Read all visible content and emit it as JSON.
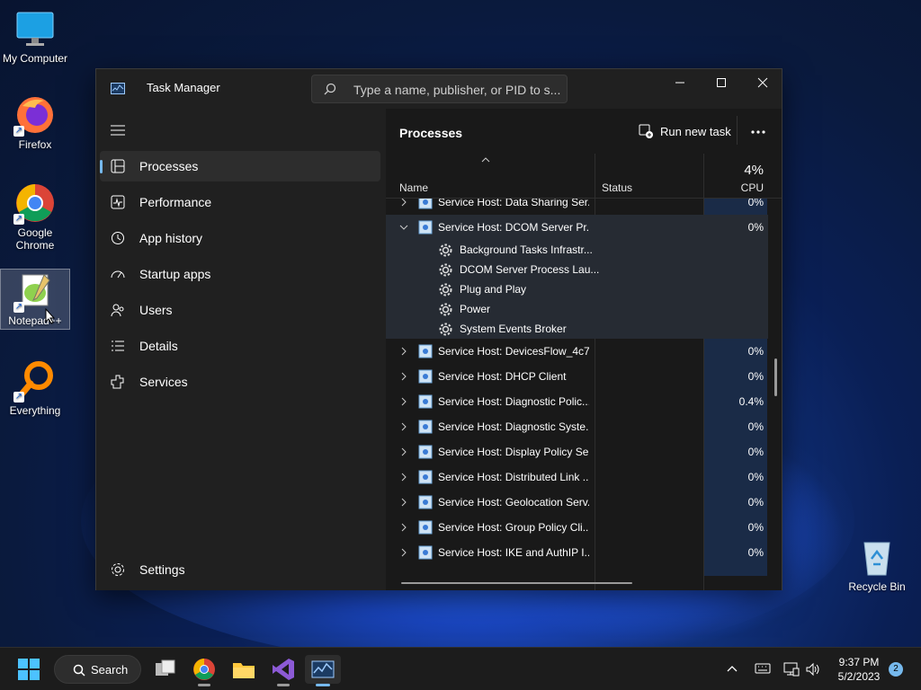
{
  "desktop": {
    "icons": [
      {
        "label": "My Computer"
      },
      {
        "label": "Firefox"
      },
      {
        "label": "Google Chrome"
      },
      {
        "label": "Notepad++"
      },
      {
        "label": "Everything"
      },
      {
        "label": "Recycle Bin"
      }
    ]
  },
  "window": {
    "title": "Task Manager",
    "search_placeholder": "Type a name, publisher, or PID to s..."
  },
  "sidebar": {
    "items": [
      {
        "label": "Processes",
        "icon": "processes-icon",
        "active": true
      },
      {
        "label": "Performance",
        "icon": "performance-icon"
      },
      {
        "label": "App history",
        "icon": "app-history-icon"
      },
      {
        "label": "Startup apps",
        "icon": "startup-apps-icon"
      },
      {
        "label": "Users",
        "icon": "users-icon"
      },
      {
        "label": "Details",
        "icon": "details-icon"
      },
      {
        "label": "Services",
        "icon": "services-icon"
      }
    ],
    "settings_label": "Settings"
  },
  "main": {
    "page_title": "Processes",
    "run_new_task": "Run new task",
    "columns": {
      "name": "Name",
      "status": "Status",
      "cpu_total": "4%",
      "cpu": "CPU"
    },
    "rows": [
      {
        "name": "Service Host: Data Sharing Ser...",
        "cpu": "0%"
      },
      {
        "name": "Service Host: DCOM Server Pr...",
        "cpu": "0%",
        "expanded": true
      },
      {
        "name": "Service Host: DevicesFlow_4c7...",
        "cpu": "0%"
      },
      {
        "name": "Service Host: DHCP Client",
        "cpu": "0%"
      },
      {
        "name": "Service Host: Diagnostic Polic...",
        "cpu": "0.4%"
      },
      {
        "name": "Service Host: Diagnostic Syste...",
        "cpu": "0%"
      },
      {
        "name": "Service Host: Display Policy Se...",
        "cpu": "0%"
      },
      {
        "name": "Service Host: Distributed Link ...",
        "cpu": "0%"
      },
      {
        "name": "Service Host: Geolocation Serv...",
        "cpu": "0%"
      },
      {
        "name": "Service Host: Group Policy Cli...",
        "cpu": "0%"
      },
      {
        "name": "Service Host: IKE and AuthIP I...",
        "cpu": "0%"
      }
    ],
    "children": [
      {
        "name": "Background Tasks Infrastr..."
      },
      {
        "name": "DCOM Server Process Lau..."
      },
      {
        "name": "Plug and Play"
      },
      {
        "name": "Power"
      },
      {
        "name": "System Events Broker"
      }
    ]
  },
  "taskbar": {
    "search_label": "Search",
    "time": "9:37 PM",
    "date": "5/2/2023",
    "notification_count": "2"
  },
  "colors": {
    "accent": "#76b9ed",
    "cpu_column": "#1a2b47",
    "window_bg": "#202020"
  }
}
